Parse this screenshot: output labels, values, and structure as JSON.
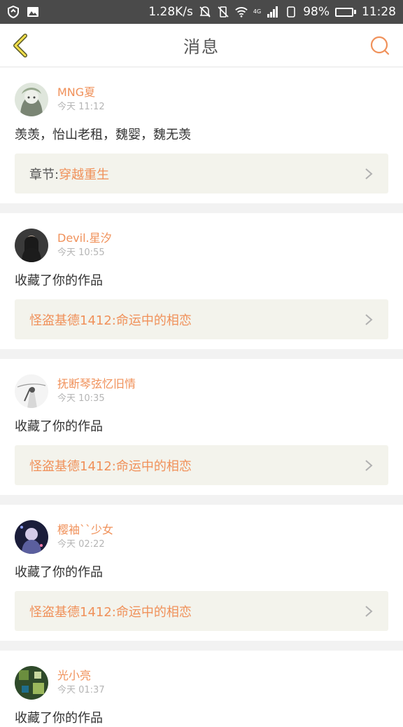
{
  "status_bar": {
    "speed": "1.28K/s",
    "network": "4G",
    "battery_percent": "98%",
    "battery_level": 0.98,
    "time": "11:28",
    "battery_color": "#3bd42d"
  },
  "header": {
    "title": "消息"
  },
  "colors": {
    "accent": "#f0915a",
    "card_bg": "#f3f3ec",
    "separator": "#f2f2f2"
  },
  "messages": [
    {
      "username": "MNG夏",
      "time": "今天 11:12",
      "content": "羡羡，怡山老租，魏婴，魏无羡",
      "card_prefix": "章节:",
      "card_title": "穿越重生"
    },
    {
      "username": "Devil.星汐",
      "time": "今天 10:55",
      "content": "收藏了你的作品",
      "card_prefix": "",
      "card_title": "怪盗基德1412:命运中的相恋"
    },
    {
      "username": "抚断琴弦忆旧情",
      "time": "今天 10:35",
      "content": "收藏了你的作品",
      "card_prefix": "",
      "card_title": "怪盗基德1412:命运中的相恋"
    },
    {
      "username": "樱袖``少女",
      "time": "今天 02:22",
      "content": "收藏了你的作品",
      "card_prefix": "",
      "card_title": "怪盗基德1412:命运中的相恋"
    },
    {
      "username": "光小亮",
      "time": "今天 01:37",
      "content": "收藏了你的作品",
      "card_prefix": "",
      "card_title": ""
    }
  ]
}
